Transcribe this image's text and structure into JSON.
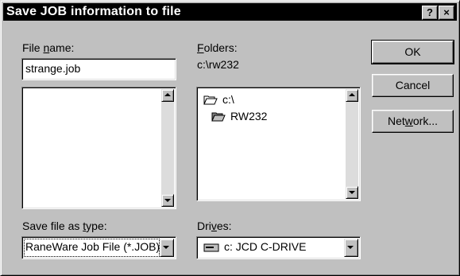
{
  "dialog": {
    "title": "Save JOB information to file",
    "help_button": "?",
    "close_button": "×"
  },
  "file_name": {
    "label_pre": "File ",
    "label_key": "n",
    "label_post": "ame:",
    "value": "strange.job"
  },
  "folders": {
    "label_key": "F",
    "label_post": "olders:",
    "current_path": "c:\\rw232",
    "items": [
      {
        "label": "c:\\",
        "icon": "open-folder-icon"
      },
      {
        "label": "RW232",
        "icon": "open-folder-icon"
      }
    ]
  },
  "buttons": {
    "ok": "OK",
    "cancel": "Cancel",
    "network_pre": "Net",
    "network_key": "w",
    "network_post": "ork..."
  },
  "save_as_type": {
    "label_pre": "Save file as ",
    "label_key": "t",
    "label_post": "ype:",
    "value": "RaneWare Job File (*.JOB)"
  },
  "drives": {
    "label_pre": "Dri",
    "label_key": "v",
    "label_post": "es:",
    "value": "c: JCD C-DRIVE",
    "icon": "drive-icon"
  }
}
